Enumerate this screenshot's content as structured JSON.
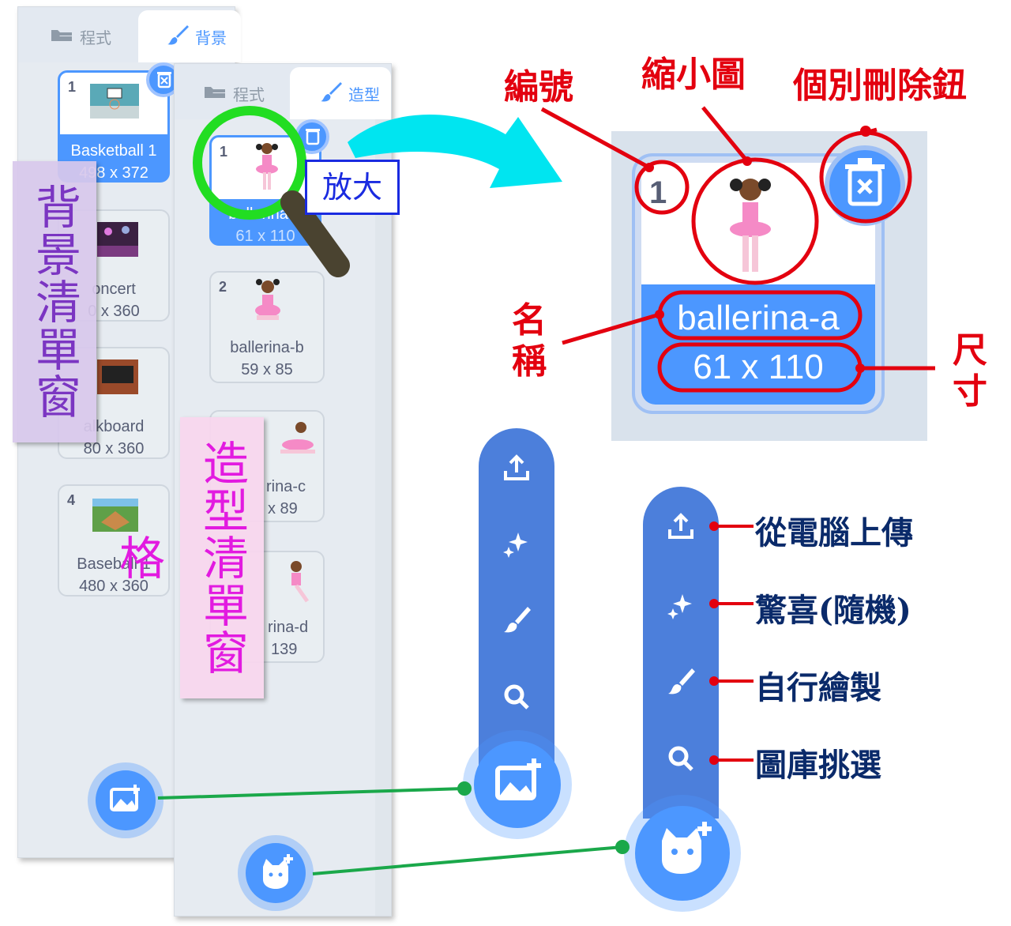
{
  "backdrop_panel": {
    "tab_code": "程式",
    "tab_backdrops": "背景",
    "items": [
      {
        "num": "1",
        "name": "Basketball 1",
        "size": "498 x 372"
      },
      {
        "num": "",
        "name": "oncert",
        "size": "0 x 360"
      },
      {
        "num": "",
        "name": "alkboard",
        "size": "80 x 360"
      },
      {
        "num": "4",
        "name": "Baseball 1",
        "size": "480 x 360"
      }
    ],
    "label": "背景清單窗格"
  },
  "costume_panel": {
    "tab_code": "程式",
    "tab_costumes": "造型",
    "items": [
      {
        "num": "1",
        "name": "ballerina-a",
        "size": "61 x 110"
      },
      {
        "num": "2",
        "name": "ballerina-b",
        "size": "59 x 85"
      },
      {
        "num": "",
        "name": "rina-c",
        "size": "x 89"
      },
      {
        "num": "",
        "name": "rina-d",
        "size": "139"
      }
    ],
    "label": "造型清單窗格"
  },
  "zoom_label": "放大",
  "detail": {
    "num": "1",
    "name": "ballerina-a",
    "size": "61 x 110"
  },
  "annotations": {
    "number": "編號",
    "thumbnail": "縮小圖",
    "delete_button": "個別刪除鈕",
    "name": "名稱",
    "size": "尺寸"
  },
  "menu_labels": {
    "upload": "從電腦上傳",
    "surprise": "驚喜(隨機)",
    "paint": "自行繪製",
    "choose": "圖庫挑選"
  },
  "colors": {
    "accent": "#4c97ff",
    "annotation_red": "#e3000f",
    "connector_green": "#1aa84a",
    "arrow_cyan": "#00e5f0",
    "zoom_green": "#22dd22",
    "backdrop_label_bg": "#d8c8ec",
    "costume_label_bg": "#f7d6ee"
  }
}
